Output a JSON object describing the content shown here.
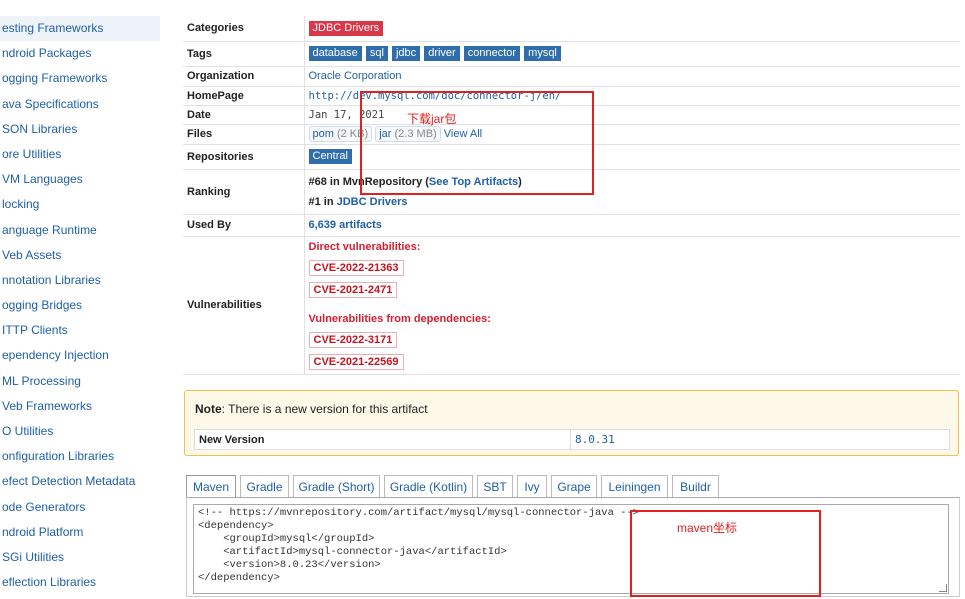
{
  "sidebar": {
    "items": [
      "esting Frameworks",
      "ndroid Packages",
      "ogging Frameworks",
      "ava Specifications",
      "SON Libraries",
      "ore Utilities",
      "VM Languages",
      "locking",
      "anguage Runtime",
      "Veb Assets",
      "nnotation Libraries",
      "ogging Bridges",
      "ITTP Clients",
      "ependency Injection",
      "ML Processing",
      "Veb Frameworks",
      "O Utilities",
      "onfiguration Libraries",
      "efect Detection Metadata",
      "ode Generators",
      "ndroid Platform",
      "SGi Utilities",
      "eflection Libraries"
    ]
  },
  "details": {
    "categories_label": "Categories",
    "category": "JDBC Drivers",
    "tags_label": "Tags",
    "tags": [
      "database",
      "sql",
      "jdbc",
      "driver",
      "connector",
      "mysql"
    ],
    "organization_label": "Organization",
    "organization": "Oracle Corporation",
    "homepage_label": "HomePage",
    "homepage": "http://dev.mysql.com/doc/connector-j/en/",
    "date_label": "Date",
    "date": "Jan 17, 2021",
    "files_label": "Files",
    "file_pom": "pom",
    "file_pom_size": "(2 KB)",
    "file_jar": "jar",
    "file_jar_size": "(2.3 MB)",
    "view_all": "View All",
    "repositories_label": "Repositories",
    "repository": "Central",
    "ranking_label": "Ranking",
    "ranking_1_prefix": "#68 in MvnRepository (",
    "ranking_1_link": "See Top Artifacts",
    "ranking_1_suffix": ")",
    "ranking_2_prefix": "#1 in ",
    "ranking_2_link": "JDBC Drivers",
    "used_by_label": "Used By",
    "used_by": "6,639 artifacts",
    "vulnerabilities_label": "Vulnerabilities",
    "direct_vuln_title": "Direct vulnerabilities:",
    "direct_vulns": [
      "CVE-2022-21363",
      "CVE-2021-2471"
    ],
    "dep_vuln_title": "Vulnerabilities from dependencies:",
    "dep_vulns": [
      "CVE-2022-3171",
      "CVE-2021-22569"
    ]
  },
  "note": {
    "bold": "Note",
    "text": ": There is a new version for this artifact",
    "new_version_label": "New Version",
    "new_version": "8.0.31"
  },
  "tabs": [
    "Maven",
    "Gradle",
    "Gradle (Short)",
    "Gradle (Kotlin)",
    "SBT",
    "Ivy",
    "Grape",
    "Leiningen",
    "Buildr"
  ],
  "code": "<!-- https://mvnrepository.com/artifact/mysql/mysql-connector-java -->\n<dependency>\n    <groupId>mysql</groupId>\n    <artifactId>mysql-connector-java</artifactId>\n    <version>8.0.23</version>\n</dependency>",
  "annotations": {
    "jar_note": "下载jar包",
    "maven_note": "maven坐标",
    "color": "#e12020"
  }
}
